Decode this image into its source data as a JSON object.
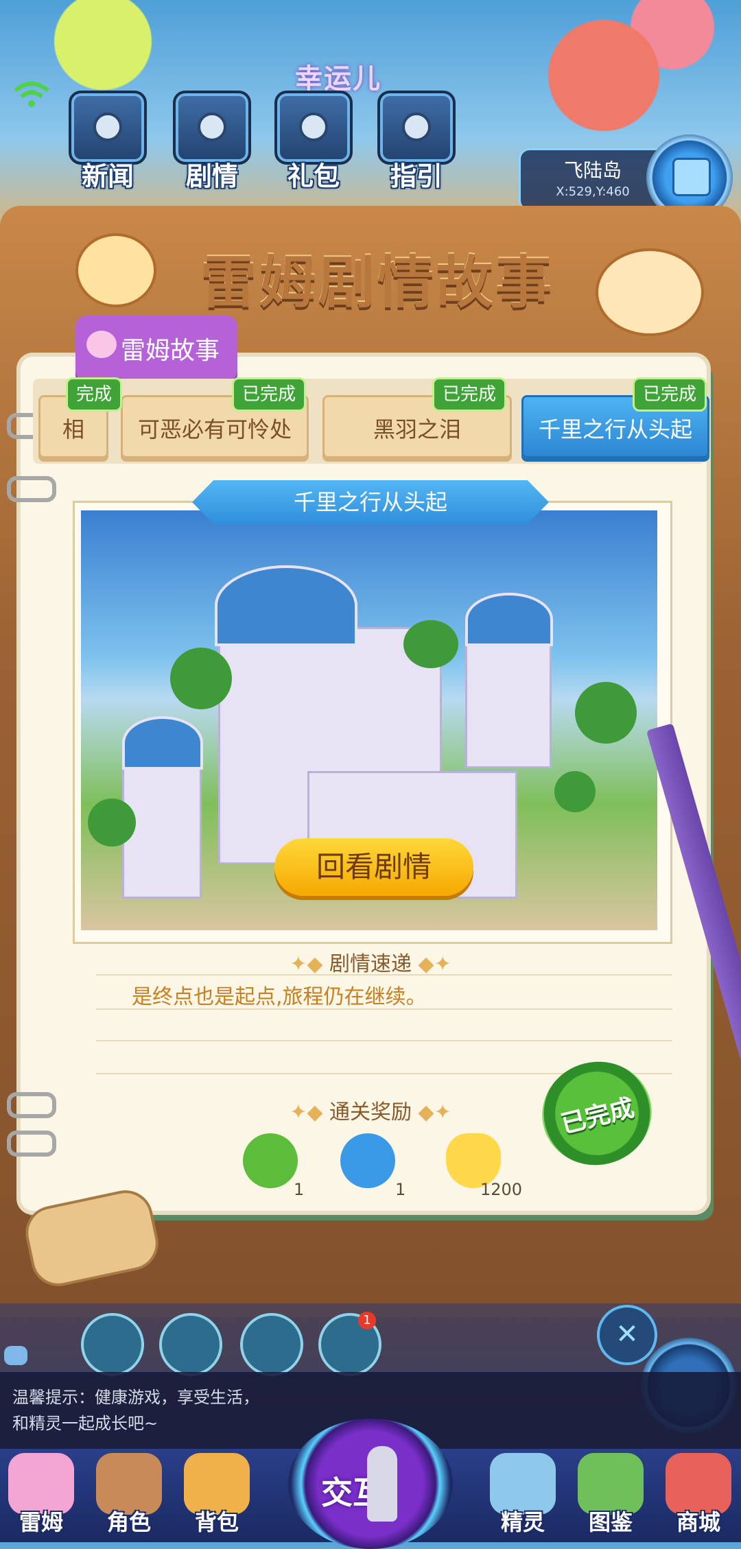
{
  "hud": {
    "lucky_text": "幸运儿",
    "buttons": [
      {
        "label": "新闻",
        "icon": "news-icon"
      },
      {
        "label": "剧情",
        "icon": "story-icon"
      },
      {
        "label": "礼包",
        "icon": "gift-icon"
      },
      {
        "label": "指引",
        "icon": "guide-icon"
      }
    ],
    "map": {
      "name": "飞陆岛",
      "coords": "X:529,Y:460"
    }
  },
  "board": {
    "title": "雷姆剧情故事"
  },
  "category_tab": {
    "label": "雷姆故事"
  },
  "chapters": [
    {
      "title": "相",
      "badge": "完成"
    },
    {
      "title": "可恶必有可怜处",
      "badge": "已完成"
    },
    {
      "title": "黑羽之泪",
      "badge": "已完成"
    },
    {
      "title": "千里之行从头起",
      "badge": "已完成",
      "active": true
    }
  ],
  "detail": {
    "title": "千里之行从头起",
    "review_button": "回看剧情",
    "summary_header": "剧情速递",
    "summary": "是终点也是起点,旅程仍在继续。",
    "rewards_header": "通关奖励",
    "rewards": [
      {
        "icon": "green-fruit-icon",
        "count": "1",
        "color": "#5bbd3a"
      },
      {
        "icon": "blue-fruit-icon",
        "count": "1",
        "color": "#3a9ae8"
      },
      {
        "icon": "cat-coin-icon",
        "count": "1200",
        "color": "#ffd84a"
      }
    ],
    "stamp": "已完成"
  },
  "chat": {
    "tip_line1": "温馨提示：健康游戏，享受生活，",
    "tip_line2": "和精灵一起成长吧~",
    "notification_count": "1"
  },
  "nav": {
    "items": [
      {
        "label": "雷姆",
        "icon": "leimu-icon",
        "color": "#f3a6d4"
      },
      {
        "label": "角色",
        "icon": "character-icon",
        "color": "#c98a5a"
      },
      {
        "label": "背包",
        "icon": "backpack-icon",
        "color": "#f0b04a"
      },
      {
        "label": "精灵",
        "icon": "spirit-icon",
        "color": "#8ec8ea"
      },
      {
        "label": "图鉴",
        "icon": "handbook-icon",
        "color": "#6fbf5a"
      },
      {
        "label": "商城",
        "icon": "shop-icon",
        "color": "#e8615a"
      }
    ],
    "center_label": "交互"
  }
}
